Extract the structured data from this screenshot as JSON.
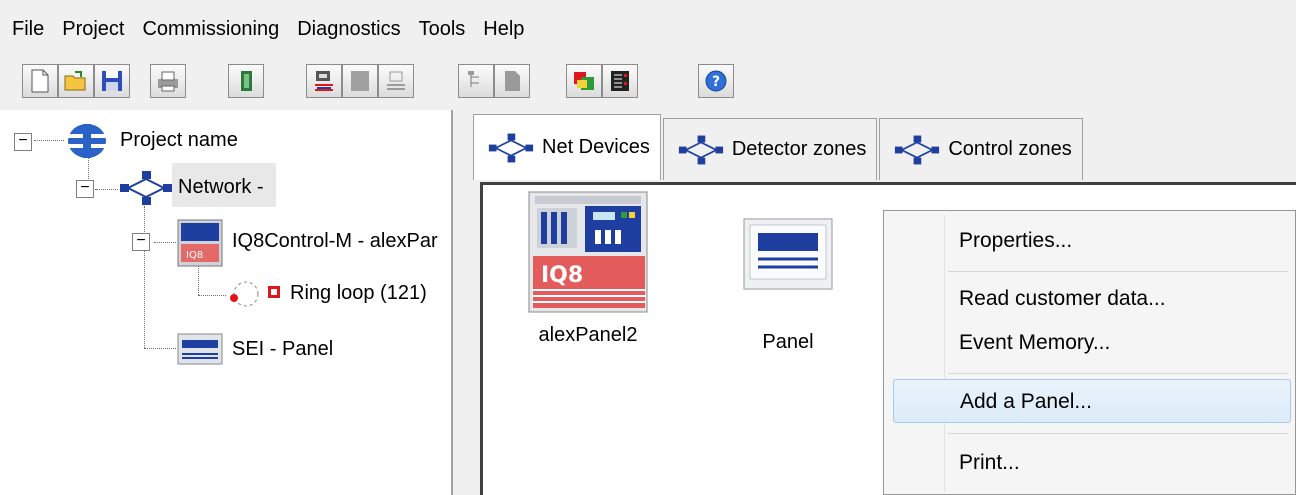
{
  "menubar": {
    "items": [
      "File",
      "Project",
      "Commissioning",
      "Diagnostics",
      "Tools",
      "Help"
    ]
  },
  "toolbar": {
    "buttons": [
      "new-icon",
      "open-icon",
      "save-icon",
      "print-icon",
      "exit-icon",
      "network-connect-icon",
      "panel-icon",
      "panel-disabled-icon",
      "tree-icon",
      "page-icon",
      "config-icon",
      "list-icon",
      "help-icon"
    ]
  },
  "tree": {
    "root": "Project name",
    "network": "Network -",
    "panel1": "IQ8Control-M - alexPar",
    "ring": "Ring loop (121)",
    "panel2": "SEI - Panel"
  },
  "tabs": [
    {
      "label": "Net Devices",
      "active": true
    },
    {
      "label": "Detector zones",
      "active": false
    },
    {
      "label": "Control zones",
      "active": false
    }
  ],
  "devices": [
    {
      "label": "alexPanel2",
      "badge": "IQ8"
    },
    {
      "label": "Panel"
    }
  ],
  "context_menu": {
    "items": [
      "Properties...",
      "Read customer data...",
      "Event Memory...",
      "Add a Panel...",
      "Print..."
    ],
    "highlighted": "Add a Panel..."
  },
  "colors": {
    "accent_red": "#e0161b",
    "selection": "#dcebf8",
    "network_blue": "#1f3fa0"
  }
}
